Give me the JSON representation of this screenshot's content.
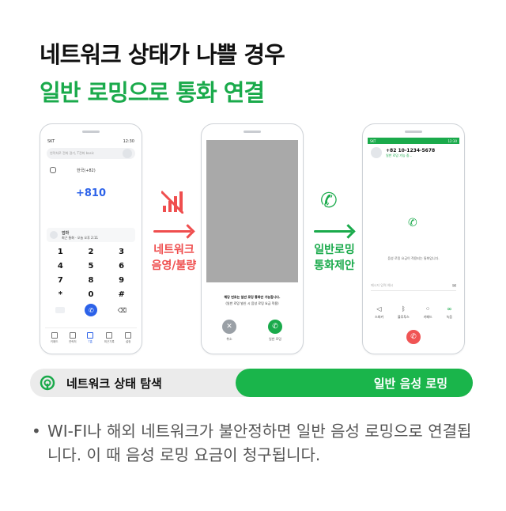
{
  "heading": {
    "line1": "네트워크 상태가 나쁠 경우",
    "line2": "일반 로밍으로 통화 연결"
  },
  "phone1": {
    "status_left": "SKT",
    "status_right": "12:30",
    "search_placeholder": "연락처로 전화 걸기, T전화 basic",
    "country": "한국(+82)",
    "number": "+810",
    "contact_name": "엄마",
    "contact_detail": "최근 통화 · 오늘 오후 2:11",
    "keys": [
      "1",
      "2",
      "3",
      "4",
      "5",
      "6",
      "7",
      "8",
      "9",
      "*",
      "0",
      "#"
    ],
    "tabs": [
      "키패드",
      "연락처",
      "T홈",
      "최근기록",
      "설정"
    ]
  },
  "phone2": {
    "message_line1": "해당 번호는 일반 로밍 통화만 가능합니다.",
    "message_line2": "(일반 로밍 발신 시 음성 로밍 요금 적용)",
    "cancel_label": "취소",
    "roaming_label": "일반 로밍"
  },
  "phone3": {
    "status_left": "SKT",
    "status_right": "12:30",
    "number": "+82 10-1234-5678",
    "sub": "일반 로밍 가능 중...",
    "message": "음성 로밍 요금이 적용되는 통화입니다.",
    "input_placeholder": "메시지 입력 예시",
    "controls": [
      "스피커",
      "블루투스",
      "키패드",
      "녹음"
    ]
  },
  "middle_left": {
    "line1": "네트워크",
    "line2": "음영/불량"
  },
  "middle_right": {
    "line1": "일반로밍",
    "line2": "통화제안"
  },
  "statusbar": {
    "left": "네트워크 상태 탐색",
    "right": "일반 음성 로밍"
  },
  "note": {
    "bullet": "•",
    "text": "WI-FI나 해외 네트워크가 불안정하면 일반 음성 로밍으로 연결됩니다. 이 때 음성 로밍 요금이 청구됩니다."
  },
  "colors": {
    "green": "#1aaa4b",
    "red": "#ef4e4e",
    "blue": "#2c62e9"
  }
}
